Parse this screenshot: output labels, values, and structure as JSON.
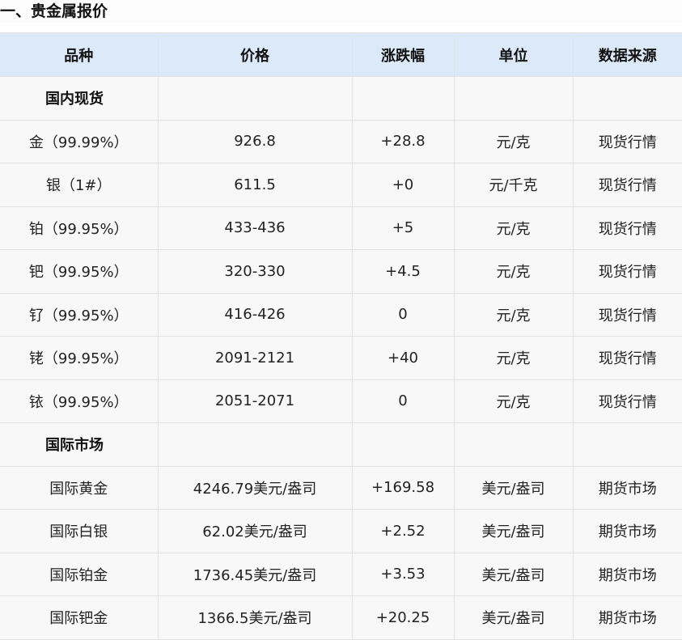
{
  "section": {
    "title": "一、贵金属报价"
  },
  "table": {
    "headers": [
      "品种",
      "价格",
      "涨跌幅",
      "单位",
      "数据来源"
    ],
    "groups": [
      {
        "label": "国内现货",
        "rows": [
          [
            "金（99.99%）",
            "926.8",
            "+28.8",
            "元/克",
            "现货行情"
          ],
          [
            "银（1#）",
            "611.5",
            "+0",
            "元/千克",
            "现货行情"
          ],
          [
            "铂（99.95%）",
            "433-436",
            "+5",
            "元/克",
            "现货行情"
          ],
          [
            "钯（99.95%）",
            "320-330",
            "+4.5",
            "元/克",
            "现货行情"
          ],
          [
            "钌（99.95%）",
            "416-426",
            "0",
            "元/克",
            "现货行情"
          ],
          [
            "铑（99.95%）",
            "2091-2121",
            "+40",
            "元/克",
            "现货行情"
          ],
          [
            "铱（99.95%）",
            "2051-2071",
            "0",
            "元/克",
            "现货行情"
          ]
        ]
      },
      {
        "label": "国际市场",
        "rows": [
          [
            "国际黄金",
            "4246.79美元/盎司",
            "+169.58",
            "美元/盎司",
            "期货市场"
          ],
          [
            "国际白银",
            "62.02美元/盎司",
            "+2.52",
            "美元/盎司",
            "期货市场"
          ],
          [
            "国际铂金",
            "1736.45美元/盎司",
            "+3.53",
            "美元/盎司",
            "期货市场"
          ],
          [
            "国际钯金",
            "1366.5美元/盎司",
            "+20.25",
            "美元/盎司",
            "期货市场"
          ]
        ]
      }
    ]
  }
}
